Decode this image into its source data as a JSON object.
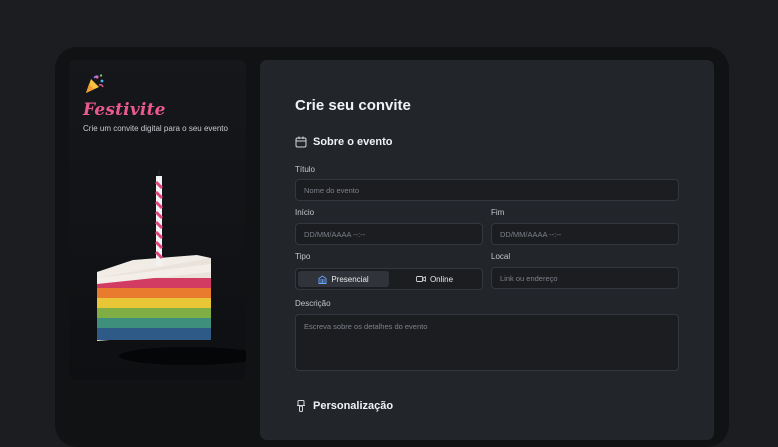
{
  "hero": {
    "brand": "Festivite",
    "tagline": "Crie um convite digital para o seu evento",
    "logo_icon": "party-popper-icon"
  },
  "form": {
    "title": "Crie seu convite",
    "section_event": {
      "title": "Sobre o evento",
      "icon": "calendar-icon"
    },
    "fields": {
      "titulo": {
        "label": "Título",
        "placeholder": "Nome do evento"
      },
      "inicio": {
        "label": "Início",
        "placeholder": "DD/MM/AAAA --:--"
      },
      "fim": {
        "label": "Fim",
        "placeholder": "DD/MM/AAAA --:--"
      },
      "tipo": {
        "label": "Tipo",
        "options": [
          {
            "label": "Presencial",
            "icon": "building-icon",
            "selected": true
          },
          {
            "label": "Online",
            "icon": "video-icon",
            "selected": false
          }
        ]
      },
      "local": {
        "label": "Local",
        "placeholder": "Link ou endereço"
      },
      "descricao": {
        "label": "Descrição",
        "placeholder": "Escreva sobre os detalhes do evento"
      }
    },
    "section_custom": {
      "title": "Personalização",
      "icon": "brush-icon"
    }
  },
  "colors": {
    "brand": "#ea5a8c",
    "panel_bg": "#22252a",
    "page_bg": "#1b1d20"
  }
}
